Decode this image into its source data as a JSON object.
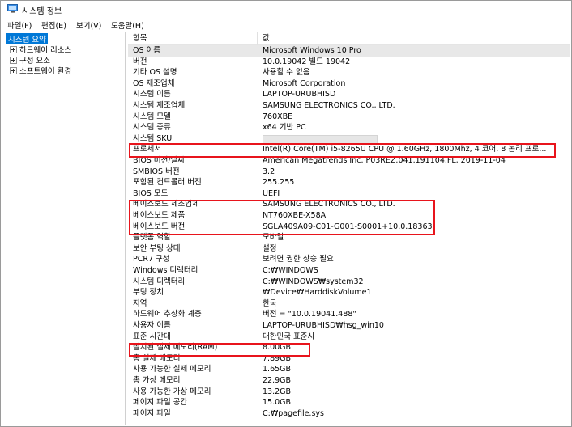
{
  "window": {
    "title": "시스템 정보",
    "icon": "system-info-icon"
  },
  "menu": [
    "파일(F)",
    "편집(E)",
    "보기(V)",
    "도움말(H)"
  ],
  "tree": [
    {
      "label": "시스템 요약",
      "selected": true,
      "expander": false
    },
    {
      "label": "하드웨어 리소스",
      "selected": false,
      "expander": true
    },
    {
      "label": "구성 요소",
      "selected": false,
      "expander": true
    },
    {
      "label": "소프트웨어 환경",
      "selected": false,
      "expander": true
    }
  ],
  "columns": {
    "item": "항목",
    "value": "값"
  },
  "rows": [
    {
      "item": "OS 이름",
      "value": "Microsoft Windows 10 Pro"
    },
    {
      "item": "버전",
      "value": "10.0.19042 빌드 19042"
    },
    {
      "item": "기타 OS 설명",
      "value": "사용할 수 없음"
    },
    {
      "item": "OS 제조업체",
      "value": "Microsoft Corporation"
    },
    {
      "item": "시스템 이름",
      "value": "LAPTOP-URUBHISD"
    },
    {
      "item": "시스템 제조업체",
      "value": "SAMSUNG ELECTRONICS CO., LTD."
    },
    {
      "item": "시스템 모델",
      "value": "760XBE"
    },
    {
      "item": "시스템 종류",
      "value": "x64 기반 PC"
    },
    {
      "item": "시스템 SKU",
      "value": ""
    },
    {
      "item": "프로세서",
      "value": "Intel(R) Core(TM) i5-8265U CPU @ 1.60GHz, 1800Mhz, 4 코어, 8 논리 프로..."
    },
    {
      "item": "BIOS 버전/날짜",
      "value": "American Megatrends Inc. P03REZ.041.191104.FL, 2019-11-04"
    },
    {
      "item": "SMBIOS 버전",
      "value": "3.2"
    },
    {
      "item": "포함된 컨트롤러 버전",
      "value": "255.255"
    },
    {
      "item": "BIOS 모드",
      "value": "UEFI"
    },
    {
      "item": "베이스보드 제조업체",
      "value": "SAMSUNG ELECTRONICS CO., LTD."
    },
    {
      "item": "베이스보드 제품",
      "value": "NT760XBE-X58A"
    },
    {
      "item": "베이스보드 버전",
      "value": "SGLA409A09-C01-G001-S0001+10.0.18363"
    },
    {
      "item": "플랫폼 역할",
      "value": "모바일"
    },
    {
      "item": "보안 부팅 상태",
      "value": "설정"
    },
    {
      "item": "PCR7 구성",
      "value": "보려면 권한 상승 필요"
    },
    {
      "item": "Windows 디렉터리",
      "value": "C:₩WINDOWS"
    },
    {
      "item": "시스템 디렉터리",
      "value": "C:₩WINDOWS₩system32"
    },
    {
      "item": "부팅 장치",
      "value": "₩Device₩HarddiskVolume1"
    },
    {
      "item": "지역",
      "value": "한국"
    },
    {
      "item": "하드웨어 추상화 계층",
      "value": "버전 = \"10.0.19041.488\""
    },
    {
      "item": "사용자 이름",
      "value": "LAPTOP-URUBHISD₩hsg_win10"
    },
    {
      "item": "표준 시간대",
      "value": "대한민국 표준시"
    },
    {
      "item": "설치된 실제 메모리(RAM)",
      "value": "8.00GB"
    },
    {
      "item": "총 실제 메모리",
      "value": "7.89GB"
    },
    {
      "item": "사용 가능한 실제 메모리",
      "value": "1.65GB"
    },
    {
      "item": "총 가상 메모리",
      "value": "22.9GB"
    },
    {
      "item": "사용 가능한 가상 메모리",
      "value": "13.2GB"
    },
    {
      "item": "페이지 파일 공간",
      "value": "15.0GB"
    },
    {
      "item": "페이지 파일",
      "value": "C:₩pagefile.sys"
    }
  ],
  "highlight_color": "#e8141c",
  "selection_color": "#0078d7"
}
